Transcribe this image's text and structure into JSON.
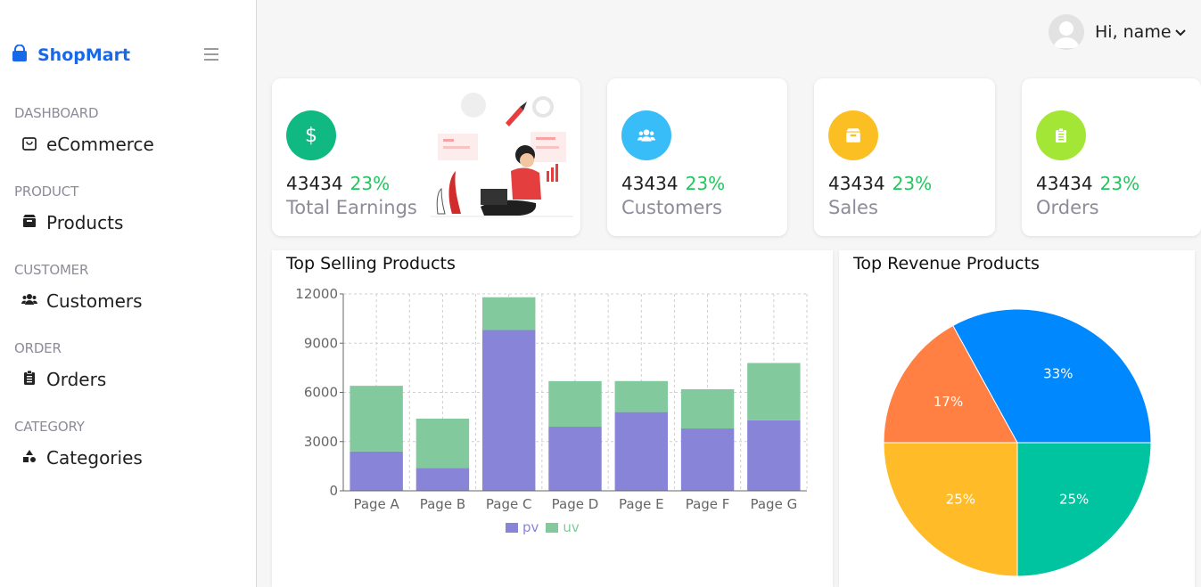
{
  "brand": {
    "name": "ShopMart",
    "color": "#1769e8",
    "icon": "shopping-bag-icon"
  },
  "sidebar": {
    "sections": [
      {
        "label": "DASHBOARD",
        "item": {
          "label": "eCommerce",
          "icon": "bag-icon"
        }
      },
      {
        "label": "PRODUCT",
        "item": {
          "label": "Products",
          "icon": "box-icon"
        }
      },
      {
        "label": "CUSTOMER",
        "item": {
          "label": "Customers",
          "icon": "users-icon"
        }
      },
      {
        "label": "ORDER",
        "item": {
          "label": "Orders",
          "icon": "clipboard-icon"
        }
      },
      {
        "label": "CATEGORY",
        "item": {
          "label": "Categories",
          "icon": "shapes-icon"
        }
      }
    ]
  },
  "header": {
    "greeting": "Hi, name"
  },
  "stats": [
    {
      "value": "43434",
      "change": "23%",
      "label": "Total Earnings",
      "icon": "dollar-icon",
      "color": "#10b981"
    },
    {
      "value": "43434",
      "change": "23%",
      "label": "Customers",
      "icon": "users-icon",
      "color": "#38bdf8"
    },
    {
      "value": "43434",
      "change": "23%",
      "label": "Sales",
      "icon": "box-icon",
      "color": "#fbbf24"
    },
    {
      "value": "43434",
      "change": "23%",
      "label": "Orders",
      "icon": "clipboard-icon",
      "color": "#a3e635"
    }
  ],
  "panels": {
    "top_selling": {
      "title": "Top Selling Products"
    },
    "top_revenue": {
      "title": "Top Revenue Products"
    }
  },
  "chart_data": [
    {
      "type": "bar",
      "stacked": true,
      "title": "Top Selling Products",
      "categories": [
        "Page A",
        "Page B",
        "Page C",
        "Page D",
        "Page E",
        "Page F",
        "Page G"
      ],
      "series": [
        {
          "name": "pv",
          "color": "#8884d8",
          "values": [
            2400,
            1398,
            9800,
            3908,
            4800,
            3800,
            4300
          ]
        },
        {
          "name": "uv",
          "color": "#82ca9d",
          "values": [
            4000,
            3000,
            2000,
            2780,
            1890,
            2390,
            3490
          ]
        }
      ],
      "ylim": [
        0,
        12000
      ],
      "yticks": [
        0,
        3000,
        6000,
        9000,
        12000
      ],
      "grid": true,
      "legend": "bottom"
    },
    {
      "type": "pie",
      "title": "Top Revenue Products",
      "slices": [
        {
          "label": "33%",
          "value": 33,
          "color": "#0088fe"
        },
        {
          "label": "17%",
          "value": 17,
          "color": "#ff8042"
        },
        {
          "label": "25%",
          "value": 25,
          "color": "#ffbb28"
        },
        {
          "label": "25%",
          "value": 25,
          "color": "#00c49f"
        }
      ]
    }
  ]
}
